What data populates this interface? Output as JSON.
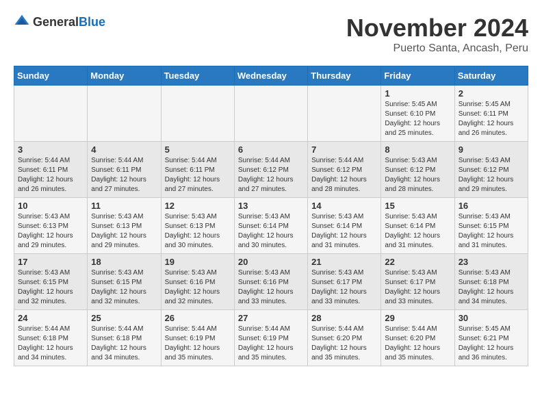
{
  "header": {
    "logo_general": "General",
    "logo_blue": "Blue",
    "month_year": "November 2024",
    "location": "Puerto Santa, Ancash, Peru"
  },
  "days_of_week": [
    "Sunday",
    "Monday",
    "Tuesday",
    "Wednesday",
    "Thursday",
    "Friday",
    "Saturday"
  ],
  "weeks": [
    [
      {
        "day": "",
        "info": ""
      },
      {
        "day": "",
        "info": ""
      },
      {
        "day": "",
        "info": ""
      },
      {
        "day": "",
        "info": ""
      },
      {
        "day": "",
        "info": ""
      },
      {
        "day": "1",
        "info": "Sunrise: 5:45 AM\nSunset: 6:10 PM\nDaylight: 12 hours and 25 minutes."
      },
      {
        "day": "2",
        "info": "Sunrise: 5:45 AM\nSunset: 6:11 PM\nDaylight: 12 hours and 26 minutes."
      }
    ],
    [
      {
        "day": "3",
        "info": "Sunrise: 5:44 AM\nSunset: 6:11 PM\nDaylight: 12 hours and 26 minutes."
      },
      {
        "day": "4",
        "info": "Sunrise: 5:44 AM\nSunset: 6:11 PM\nDaylight: 12 hours and 27 minutes."
      },
      {
        "day": "5",
        "info": "Sunrise: 5:44 AM\nSunset: 6:11 PM\nDaylight: 12 hours and 27 minutes."
      },
      {
        "day": "6",
        "info": "Sunrise: 5:44 AM\nSunset: 6:12 PM\nDaylight: 12 hours and 27 minutes."
      },
      {
        "day": "7",
        "info": "Sunrise: 5:44 AM\nSunset: 6:12 PM\nDaylight: 12 hours and 28 minutes."
      },
      {
        "day": "8",
        "info": "Sunrise: 5:43 AM\nSunset: 6:12 PM\nDaylight: 12 hours and 28 minutes."
      },
      {
        "day": "9",
        "info": "Sunrise: 5:43 AM\nSunset: 6:12 PM\nDaylight: 12 hours and 29 minutes."
      }
    ],
    [
      {
        "day": "10",
        "info": "Sunrise: 5:43 AM\nSunset: 6:13 PM\nDaylight: 12 hours and 29 minutes."
      },
      {
        "day": "11",
        "info": "Sunrise: 5:43 AM\nSunset: 6:13 PM\nDaylight: 12 hours and 29 minutes."
      },
      {
        "day": "12",
        "info": "Sunrise: 5:43 AM\nSunset: 6:13 PM\nDaylight: 12 hours and 30 minutes."
      },
      {
        "day": "13",
        "info": "Sunrise: 5:43 AM\nSunset: 6:14 PM\nDaylight: 12 hours and 30 minutes."
      },
      {
        "day": "14",
        "info": "Sunrise: 5:43 AM\nSunset: 6:14 PM\nDaylight: 12 hours and 31 minutes."
      },
      {
        "day": "15",
        "info": "Sunrise: 5:43 AM\nSunset: 6:14 PM\nDaylight: 12 hours and 31 minutes."
      },
      {
        "day": "16",
        "info": "Sunrise: 5:43 AM\nSunset: 6:15 PM\nDaylight: 12 hours and 31 minutes."
      }
    ],
    [
      {
        "day": "17",
        "info": "Sunrise: 5:43 AM\nSunset: 6:15 PM\nDaylight: 12 hours and 32 minutes."
      },
      {
        "day": "18",
        "info": "Sunrise: 5:43 AM\nSunset: 6:15 PM\nDaylight: 12 hours and 32 minutes."
      },
      {
        "day": "19",
        "info": "Sunrise: 5:43 AM\nSunset: 6:16 PM\nDaylight: 12 hours and 32 minutes."
      },
      {
        "day": "20",
        "info": "Sunrise: 5:43 AM\nSunset: 6:16 PM\nDaylight: 12 hours and 33 minutes."
      },
      {
        "day": "21",
        "info": "Sunrise: 5:43 AM\nSunset: 6:17 PM\nDaylight: 12 hours and 33 minutes."
      },
      {
        "day": "22",
        "info": "Sunrise: 5:43 AM\nSunset: 6:17 PM\nDaylight: 12 hours and 33 minutes."
      },
      {
        "day": "23",
        "info": "Sunrise: 5:43 AM\nSunset: 6:18 PM\nDaylight: 12 hours and 34 minutes."
      }
    ],
    [
      {
        "day": "24",
        "info": "Sunrise: 5:44 AM\nSunset: 6:18 PM\nDaylight: 12 hours and 34 minutes."
      },
      {
        "day": "25",
        "info": "Sunrise: 5:44 AM\nSunset: 6:18 PM\nDaylight: 12 hours and 34 minutes."
      },
      {
        "day": "26",
        "info": "Sunrise: 5:44 AM\nSunset: 6:19 PM\nDaylight: 12 hours and 35 minutes."
      },
      {
        "day": "27",
        "info": "Sunrise: 5:44 AM\nSunset: 6:19 PM\nDaylight: 12 hours and 35 minutes."
      },
      {
        "day": "28",
        "info": "Sunrise: 5:44 AM\nSunset: 6:20 PM\nDaylight: 12 hours and 35 minutes."
      },
      {
        "day": "29",
        "info": "Sunrise: 5:44 AM\nSunset: 6:20 PM\nDaylight: 12 hours and 35 minutes."
      },
      {
        "day": "30",
        "info": "Sunrise: 5:45 AM\nSunset: 6:21 PM\nDaylight: 12 hours and 36 minutes."
      }
    ]
  ]
}
